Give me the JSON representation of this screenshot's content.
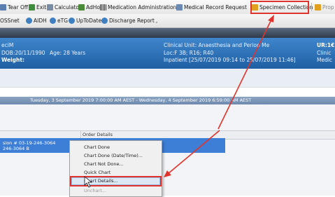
{
  "toolbar1": {
    "items": [
      {
        "label": "Tear Off",
        "icon": "tear-off-icon",
        "color": "#5b7fb0"
      },
      {
        "label": "Exit",
        "icon": "exit-icon",
        "color": "#3e8e3e"
      },
      {
        "label": "Calculator",
        "icon": "calculator-icon",
        "color": "#7a8ca6"
      },
      {
        "label": "AdHoc",
        "icon": "adhoc-icon",
        "color": "#4a8a3a"
      },
      {
        "label": "Medication Administration",
        "icon": "barcode-icon",
        "color": "#222222"
      },
      {
        "label": "Medical Record Request",
        "icon": "record-request-icon",
        "color": "#6a8ab4"
      },
      {
        "label": "Specimen Collection",
        "icon": "specimen-icon",
        "color": "#e0a020"
      },
      {
        "label": "Prop",
        "icon": "prop-icon",
        "color": "#e0a020"
      }
    ]
  },
  "toolbar2": {
    "items": [
      {
        "label": "OSSnet",
        "icon": "",
        "color": ""
      },
      {
        "label": "AIDH",
        "icon": "link-icon",
        "color": "#3d7fc0"
      },
      {
        "label": "eTG",
        "icon": "link-icon",
        "color": "#3d7fc0"
      },
      {
        "label": "UpToDate",
        "icon": "link-icon",
        "color": "#3d7fc0"
      },
      {
        "label": "Discharge Report",
        "icon": "link-icon",
        "color": "#3d7fc0"
      }
    ],
    "trailing": ","
  },
  "banner": {
    "name": "eciM",
    "dob": "DOB:20/11/1990",
    "age": "Age: 28 Years",
    "weight": "Weight:",
    "unit": "Clinical Unit: Anaesthesia and Periop Me",
    "loc": "Loc:F 3B; R16; R40",
    "inpatient": "Inpatient [25/07/2019 09:14 to 25/07/2019 11:46]",
    "ur": "UR:1€",
    "clinic": "Clinic",
    "medic": "Medic"
  },
  "date_range": "Tuesday, 3 September 2019 7:00:00 AM AEST - Wednesday, 4 September 2019 6:59:00 AM AEST",
  "grid": {
    "column_header": "Order Details",
    "row_line1": "sion # 03-19-246-3064",
    "row_line2": "246-3064 B"
  },
  "context_menu": {
    "items": [
      {
        "label": "Chart Done",
        "enabled": true
      },
      {
        "label": "Chart Done (Date/Time)...",
        "enabled": true
      },
      {
        "label": "Chart Not Done...",
        "enabled": true
      },
      {
        "label": "Quick Chart",
        "enabled": true
      },
      {
        "label": "Chart Details...",
        "enabled": true,
        "highlighted": true
      },
      {
        "label": "Unchart...",
        "enabled": false
      }
    ]
  },
  "colors": {
    "annotation": "#e0332b",
    "banner": "#2f73bb",
    "selected_row": "#3d7fd6"
  }
}
